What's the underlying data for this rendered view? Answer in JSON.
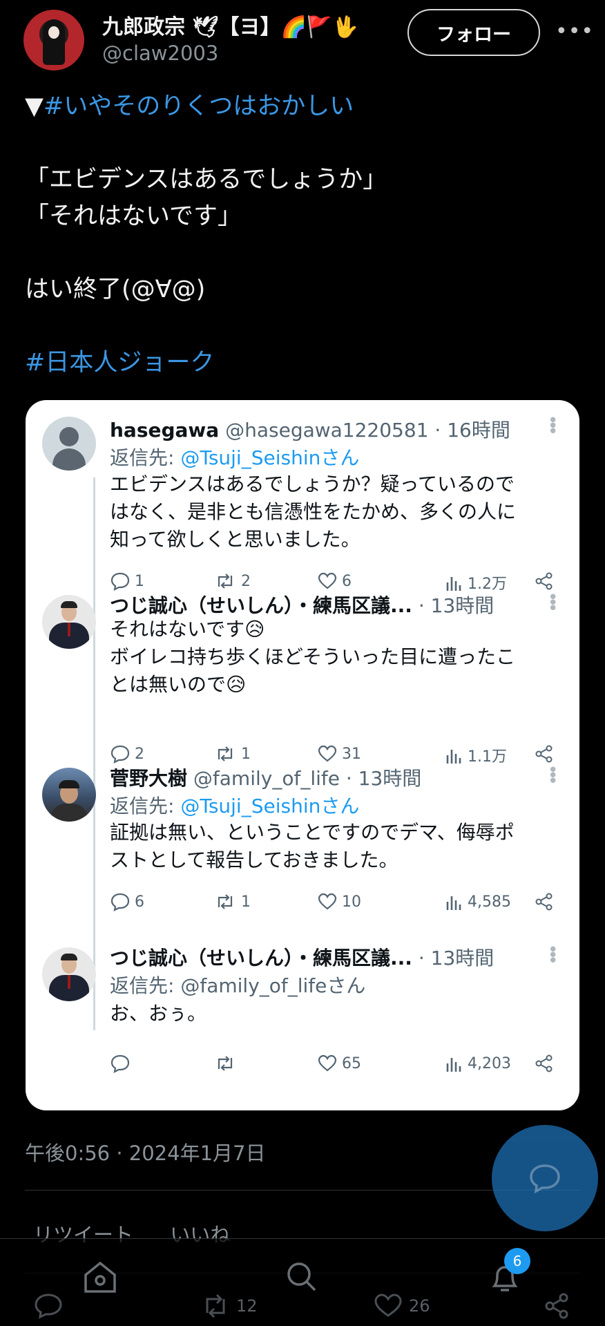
{
  "author": {
    "display_name": "九郎政宗 🕊【ヨ】🌈🚩🖖",
    "handle": "@claw2003"
  },
  "follow_label": "フォロー",
  "tweet": {
    "lines": [
      {
        "prefix": "▼",
        "hashtag": "#いやそのりくつはおかしい"
      },
      {
        "text": ""
      },
      {
        "text": "「エビデンスはあるでしょうか」"
      },
      {
        "text": "「それはないです」"
      },
      {
        "text": ""
      },
      {
        "text": "はい終了(@∀@)"
      },
      {
        "text": ""
      },
      {
        "hashtag": "#日本人ジョーク"
      }
    ]
  },
  "embedded_thread": [
    {
      "name": "hasegawa",
      "meta": "@hasegawa1220581 · 16時間",
      "reply_to_label": "返信先: ",
      "reply_to": "@Tsuji_Seishinさん",
      "body": [
        "エビデンスはあるでしょうか？疑っているので",
        "はなく、是非とも信憑性をたかめ、多くの人に",
        "知って欲しくと思いました。"
      ],
      "replies": "1",
      "retweets": "2",
      "likes": "6",
      "views": "1.2万"
    },
    {
      "name": "つじ誠心（せいしん）・練馬区議...",
      "meta": " · 13時間",
      "reply_to_label": "",
      "reply_to": "",
      "body": [
        "それはないです😥",
        "ボイレコ持ち歩くほどそういった目に遭ったこ",
        "とは無いので😥"
      ],
      "replies": "2",
      "retweets": "1",
      "likes": "31",
      "views": "1.1万"
    },
    {
      "name": "菅野大樹",
      "meta": " @family_of_life · 13時間",
      "reply_to_label": "返信先: ",
      "reply_to": "@Tsuji_Seishinさん",
      "body": [
        "証拠は無い、ということですのでデマ、侮辱ポ",
        "ストとして報告しておきました。"
      ],
      "replies": "6",
      "retweets": "1",
      "likes": "10",
      "views": "4,585"
    },
    {
      "name": "つじ誠心（せいしん）・練馬区議...",
      "meta": " · 13時間",
      "reply_to_label": "返信先: ",
      "reply_to": "@family_of_lifeさん",
      "body": [
        "お、おぅ。"
      ],
      "replies": "",
      "retweets": "",
      "likes": "65",
      "views": "4,203"
    }
  ],
  "timestamp": "午後0:56 · 2024年1月7日",
  "stats": {
    "retweets_label": "リツイート",
    "likes_label": "いいね"
  },
  "under_actions": {
    "retweets": "12",
    "likes": "26"
  },
  "notifications_badge": "6",
  "colors": {
    "link": "#3b97e4",
    "background": "#000000",
    "card": "#ffffff",
    "badge": "#1d9bf0"
  }
}
